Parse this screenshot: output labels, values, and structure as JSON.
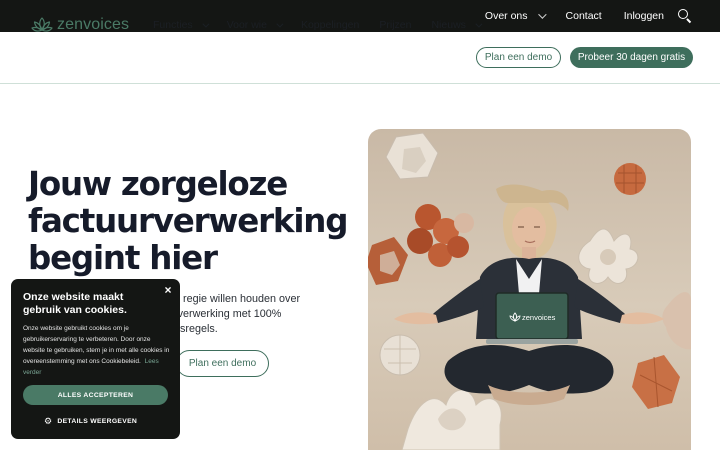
{
  "topbar": {
    "items": [
      {
        "label": "Over ons",
        "has_dropdown": true
      },
      {
        "label": "Contact",
        "has_dropdown": false
      },
      {
        "label": "Inloggen",
        "has_dropdown": false
      }
    ],
    "search_icon": "search-icon"
  },
  "nav": {
    "logo_text": "zenvoices",
    "logo_icon": "lotus-icon",
    "menu": [
      {
        "label": "Functies",
        "has_dropdown": true
      },
      {
        "label": "Voor wie",
        "has_dropdown": true
      },
      {
        "label": "Koppelingen",
        "has_dropdown": false
      },
      {
        "label": "Prijzen",
        "has_dropdown": false
      },
      {
        "label": "Nieuws",
        "has_dropdown": true
      }
    ],
    "demo_button": "Plan een demo",
    "trial_button": "Probeer 30 dagen gratis"
  },
  "hero": {
    "title_lines": [
      "Jouw zorgeloze",
      "factuurverwerking",
      "begint hier"
    ],
    "subtitle_lines": [
      "e regie willen houden over",
      "rverwerking met 100%",
      "gsregels."
    ],
    "demo_button": "Plan een demo",
    "laptop_logo_text": "zenvoices"
  },
  "cookie": {
    "title": "Onze website maakt gebruik van cookies.",
    "body": "Onze website gebruikt cookies om je gebruikerservaring te verbeteren. Door onze website te gebruiken, stem je in met alle cookies in overeenstemming met ons Cookiebeleid.",
    "more_link": "Lees verder",
    "accept_button": "ALLES ACCEPTEREN",
    "details_button": "DETAILS WEERGEVEN",
    "close_symbol": "×"
  },
  "colors": {
    "brand_green": "#3e6e5c",
    "topbar_bg": "#141614",
    "heading": "#161b2a"
  }
}
